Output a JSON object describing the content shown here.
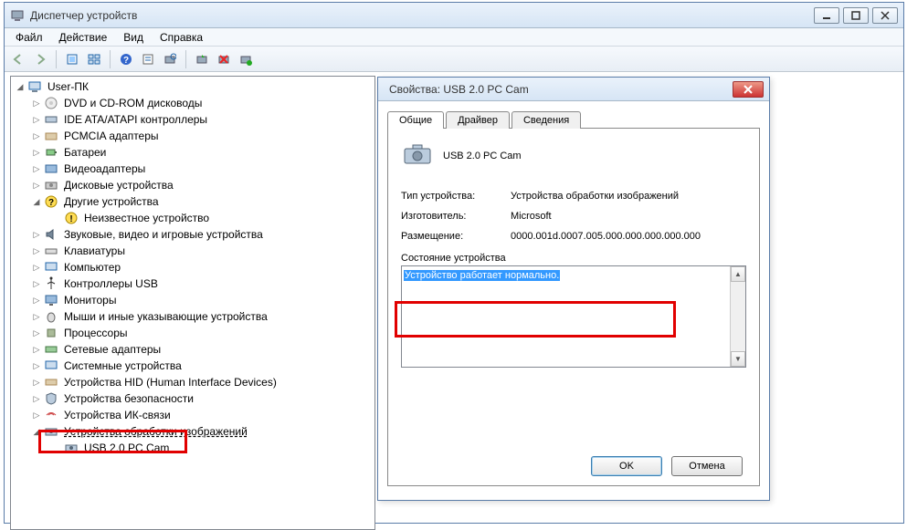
{
  "window": {
    "title": "Диспетчер устройств"
  },
  "menu": {
    "file": "Файл",
    "action": "Действие",
    "view": "Вид",
    "help": "Справка"
  },
  "tree": {
    "root": "User-ПК",
    "n0": "DVD и CD-ROM дисководы",
    "n1": "IDE ATA/ATAPI контроллеры",
    "n2": "PCMCIA адаптеры",
    "n3": "Батареи",
    "n4": "Видеоадаптеры",
    "n5": "Дисковые устройства",
    "n6": "Другие устройства",
    "n6a": "Неизвестное устройство",
    "n7": "Звуковые, видео и игровые устройства",
    "n8": "Клавиатуры",
    "n9": "Компьютер",
    "n10": "Контроллеры USB",
    "n11": "Мониторы",
    "n12": "Мыши и иные указывающие устройства",
    "n13": "Процессоры",
    "n14": "Сетевые адаптеры",
    "n15": "Системные устройства",
    "n16": "Устройства HID (Human Interface Devices)",
    "n17": "Устройства безопасности",
    "n18": "Устройства ИК-связи",
    "n19": "Устройства обработки изображений",
    "n19a": "USB 2.0 PC Cam"
  },
  "dialog": {
    "title": "Свойства: USB 2.0 PC Cam",
    "tabs": {
      "general": "Общие",
      "driver": "Драйвер",
      "details": "Сведения"
    },
    "device_name": "USB 2.0 PC Cam",
    "labels": {
      "type": "Тип устройства:",
      "mfg": "Изготовитель:",
      "loc": "Размещение:"
    },
    "values": {
      "type": "Устройства обработки изображений",
      "mfg": "Microsoft",
      "loc": "0000.001d.0007.005.000.000.000.000.000"
    },
    "status_label": "Состояние устройства",
    "status_text": "Устройство работает нормально.",
    "ok": "OK",
    "cancel": "Отмена"
  }
}
